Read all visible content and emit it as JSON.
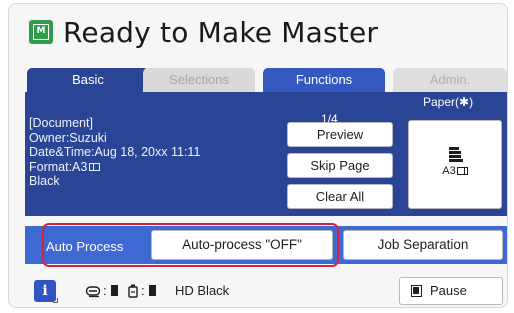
{
  "header": {
    "title": "Ready to Make Master",
    "icon": "master-icon"
  },
  "tabs": [
    {
      "label": "Basic",
      "state": "active"
    },
    {
      "label": "Selections",
      "state": "disabled"
    },
    {
      "label": "Functions",
      "state": "inactive"
    },
    {
      "label": "Admin.",
      "state": "disabled"
    }
  ],
  "document": {
    "heading": "[Document]",
    "owner": "Owner:Suzuki",
    "datetime": "Date&Time:Aug 18, 20xx 11:11",
    "format": "Format:A3",
    "color": "Black"
  },
  "preview": {
    "page_counter": "1/4",
    "preview_label": "Preview",
    "skip_page_label": "Skip Page",
    "clear_all_label": "Clear All"
  },
  "paper": {
    "label": "Paper(✱)",
    "size": "A3",
    "icon": "paper-tray-icon"
  },
  "auto_process": {
    "label": "Auto Process",
    "button_label": "Auto-process \"OFF\"",
    "job_separation_label": "Job Separation"
  },
  "status_bar": {
    "info_icon": "info-icon",
    "drum_icon": "drum-icon",
    "ink_icon": "ink-icon",
    "status_text": "HD Black",
    "pause_label": "Pause"
  },
  "colors": {
    "tab_active": "#2a4596",
    "tab_functions": "#3458bf",
    "panel": "#2a4596",
    "band": "#3e69d3",
    "highlight": "#d9213f",
    "title_icon": "#2f9d4a"
  }
}
